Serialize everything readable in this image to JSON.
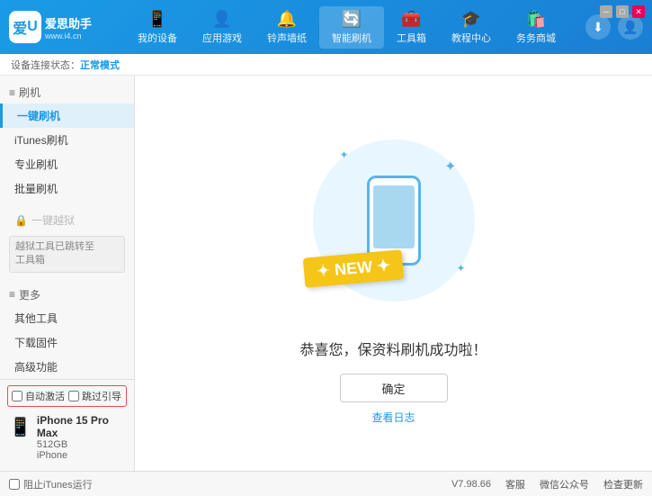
{
  "header": {
    "logo_icon": "爱",
    "logo_name": "爱思助手",
    "logo_url": "www.i4.cn",
    "nav": [
      {
        "id": "my-device",
        "label": "我的设备",
        "icon": "📱"
      },
      {
        "id": "app-games",
        "label": "应用游戏",
        "icon": "👤"
      },
      {
        "id": "ringtone",
        "label": "铃声墙纸",
        "icon": "🔔"
      },
      {
        "id": "smart-flash",
        "label": "智能刷机",
        "icon": "🔄"
      },
      {
        "id": "toolbox",
        "label": "工具箱",
        "icon": "🧰"
      },
      {
        "id": "tutorial",
        "label": "教程中心",
        "icon": "🎓"
      },
      {
        "id": "service",
        "label": "务务商城",
        "icon": "🛍️"
      }
    ],
    "download_icon": "⬇",
    "user_icon": "👤"
  },
  "connection_status": {
    "label": "设备连接状态：",
    "mode": "正常模式"
  },
  "sidebar": {
    "flash_section": "刷机",
    "items": [
      {
        "id": "one-key-flash",
        "label": "一键刷机",
        "active": true
      },
      {
        "id": "itunes-flash",
        "label": "iTunes刷机",
        "active": false
      },
      {
        "id": "pro-flash",
        "label": "专业刷机",
        "active": false
      },
      {
        "id": "batch-flash",
        "label": "批量刷机",
        "active": false
      }
    ],
    "disabled_item": "一键越狱",
    "warning_line1": "越狱工具已跳转至",
    "warning_line2": "工具箱",
    "more_section": "更多",
    "more_items": [
      {
        "id": "other-tools",
        "label": "其他工具"
      },
      {
        "id": "download-firmware",
        "label": "下载固件"
      },
      {
        "id": "advanced",
        "label": "高级功能"
      }
    ],
    "bottom": {
      "auto_activate": "自动激活",
      "auto_guide": "跳过引导",
      "device_name": "iPhone 15 Pro Max",
      "device_storage": "512GB",
      "device_type": "iPhone"
    }
  },
  "content": {
    "new_badge": "NEW",
    "success_message": "恭喜您，保资料刷机成功啦！",
    "confirm_button": "确定",
    "log_link": "查看日志"
  },
  "statusbar": {
    "version": "V7.98.66",
    "items": [
      {
        "id": "home",
        "label": "客服"
      },
      {
        "id": "wechat",
        "label": "微信公众号"
      },
      {
        "id": "check-update",
        "label": "检查更新"
      }
    ],
    "stop_itunes": "阻止iTunes运行"
  }
}
